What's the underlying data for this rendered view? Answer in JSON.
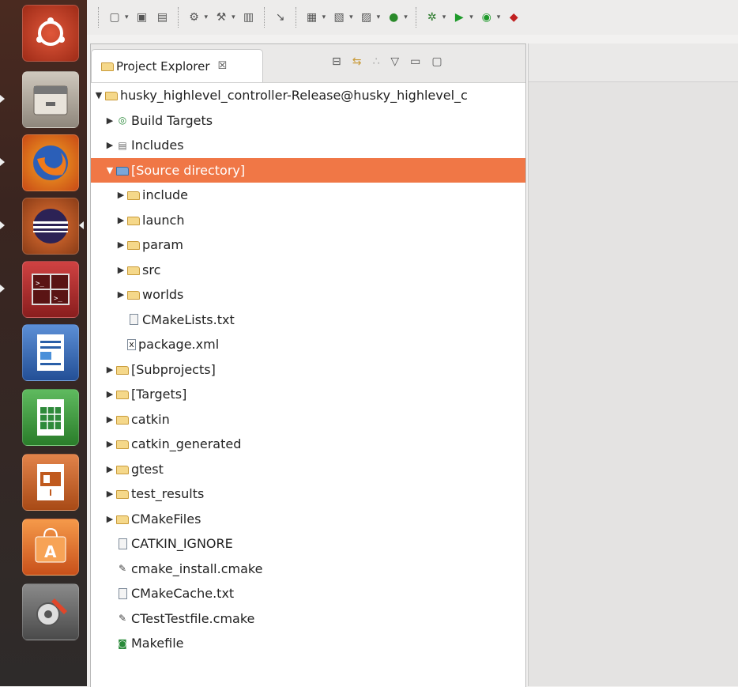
{
  "launcher": {
    "items": [
      {
        "name": "ubuntu-dash-icon",
        "color": "#d44a2c"
      },
      {
        "name": "files-icon",
        "color": "#a49a8c"
      },
      {
        "name": "firefox-icon",
        "color": "#e96b1f"
      },
      {
        "name": "eclipse-icon",
        "color": "#2c2255"
      },
      {
        "name": "terminal-icon",
        "color": "#c02c2c"
      },
      {
        "name": "writer-icon",
        "color": "#2a5fa8"
      },
      {
        "name": "calc-icon",
        "color": "#2e8a3a"
      },
      {
        "name": "impress-icon",
        "color": "#c05a1e"
      },
      {
        "name": "software-center-icon",
        "color": "#e86a1f"
      },
      {
        "name": "settings-icon",
        "color": "#7a7a7a"
      }
    ]
  },
  "project_explorer": {
    "tab_title": "Project Explorer",
    "tab_close": "☒",
    "tree": [
      {
        "label": "husky_highlevel_controller-Release@husky_highlevel_c",
        "indent": 0,
        "twisty": "▼",
        "icon": "project"
      },
      {
        "label": "Build Targets",
        "indent": 1,
        "twisty": "▶",
        "icon": "target"
      },
      {
        "label": "Includes",
        "indent": 1,
        "twisty": "▶",
        "icon": "includes"
      },
      {
        "label": "[Source directory]",
        "indent": 1,
        "twisty": "▼",
        "icon": "srcdir",
        "selected": true
      },
      {
        "label": "include",
        "indent": 2,
        "twisty": "▶",
        "icon": "folder"
      },
      {
        "label": "launch",
        "indent": 2,
        "twisty": "▶",
        "icon": "folder"
      },
      {
        "label": "param",
        "indent": 2,
        "twisty": "▶",
        "icon": "folder"
      },
      {
        "label": "src",
        "indent": 2,
        "twisty": "▶",
        "icon": "folder"
      },
      {
        "label": "worlds",
        "indent": 2,
        "twisty": "▶",
        "icon": "folder"
      },
      {
        "label": "CMakeLists.txt",
        "indent": 2,
        "twisty": "",
        "icon": "file"
      },
      {
        "label": "package.xml",
        "indent": 2,
        "twisty": "",
        "icon": "xml"
      },
      {
        "label": "[Subprojects]",
        "indent": 1,
        "twisty": "▶",
        "icon": "folder"
      },
      {
        "label": "[Targets]",
        "indent": 1,
        "twisty": "▶",
        "icon": "folder"
      },
      {
        "label": "catkin",
        "indent": 1,
        "twisty": "▶",
        "icon": "folder"
      },
      {
        "label": "catkin_generated",
        "indent": 1,
        "twisty": "▶",
        "icon": "folder"
      },
      {
        "label": "gtest",
        "indent": 1,
        "twisty": "▶",
        "icon": "folder"
      },
      {
        "label": "test_results",
        "indent": 1,
        "twisty": "▶",
        "icon": "folder"
      },
      {
        "label": "CMakeFiles",
        "indent": 1,
        "twisty": "▶",
        "icon": "folder"
      },
      {
        "label": "CATKIN_IGNORE",
        "indent": 1,
        "twisty": "",
        "icon": "file"
      },
      {
        "label": "cmake_install.cmake",
        "indent": 1,
        "twisty": "",
        "icon": "cmake"
      },
      {
        "label": "CMakeCache.txt",
        "indent": 1,
        "twisty": "",
        "icon": "file"
      },
      {
        "label": "CTestTestfile.cmake",
        "indent": 1,
        "twisty": "",
        "icon": "cmake"
      },
      {
        "label": "Makefile",
        "indent": 1,
        "twisty": "",
        "icon": "makefile"
      }
    ]
  },
  "colors": {
    "selection": "#f07746"
  }
}
